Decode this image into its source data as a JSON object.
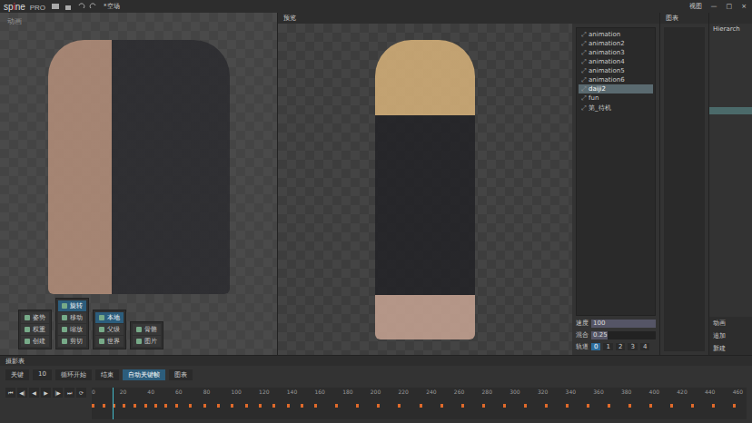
{
  "app": {
    "logo": "sp",
    "logo_i": "i",
    "logo_end": "ne",
    "edition": "PRO",
    "title": "*空场",
    "view_menu": "视图",
    "window_controls": [
      "—",
      "□",
      "×"
    ]
  },
  "viewport": {
    "label": "动画",
    "art": "canvas artwork (not reproduced)"
  },
  "tool_groups": [
    {
      "name": "Tools",
      "items": [
        {
          "label": "姿势",
          "selected": false
        },
        {
          "label": "权重",
          "selected": false
        },
        {
          "label": "创建",
          "selected": false
        }
      ]
    },
    {
      "name": "Transform",
      "items": [
        {
          "label": "旋转",
          "selected": true
        },
        {
          "label": "移动",
          "selected": false
        },
        {
          "label": "缩放",
          "selected": false
        },
        {
          "label": "剪切",
          "selected": false
        }
      ]
    },
    {
      "name": "Axes",
      "items": [
        {
          "label": "本地",
          "selected": true
        },
        {
          "label": "父级",
          "selected": false
        },
        {
          "label": "世界",
          "selected": false
        }
      ]
    },
    {
      "name": "Compensate",
      "items": [
        {
          "label": "骨骼",
          "selected": false
        },
        {
          "label": "图片",
          "selected": false
        }
      ]
    }
  ],
  "preview": {
    "tab": "预览",
    "art": "preview artwork (not reproduced)",
    "animations": [
      {
        "label": "animation",
        "selected": false
      },
      {
        "label": "animation2",
        "selected": false
      },
      {
        "label": "animation3",
        "selected": false
      },
      {
        "label": "animation4",
        "selected": false
      },
      {
        "label": "animation5",
        "selected": false
      },
      {
        "label": "animation6",
        "selected": false
      },
      {
        "label": "daiji2",
        "selected": true
      },
      {
        "label": "fun",
        "selected": false
      },
      {
        "label": "第_待机",
        "selected": false
      }
    ],
    "speed": {
      "label": "速度",
      "value": "100",
      "level": 1.0
    },
    "mix": {
      "label": "混合",
      "value": "0.25",
      "level": 0.25
    },
    "tracks": {
      "label": "轨道",
      "items": [
        {
          "label": "0",
          "selected": true
        },
        {
          "label": "1",
          "selected": false
        },
        {
          "label": "2",
          "selected": false
        },
        {
          "label": "3",
          "selected": false
        },
        {
          "label": "4",
          "selected": false
        }
      ]
    }
  },
  "graph_panel": {
    "title": "图表"
  },
  "hierarchy": {
    "title": "Hierarch",
    "footer": [
      "动画",
      "追加",
      "新建"
    ]
  },
  "timeline": {
    "title": "摄影表",
    "fields": [
      "关键",
      "10",
      "循环开始",
      "结束"
    ],
    "auto_key": {
      "label": "自动关键帧",
      "on": true
    },
    "graph_button": "图表",
    "transport": [
      "⏮",
      "◀|",
      "◀",
      "▶",
      "|▶",
      "⏭",
      "⟳"
    ],
    "ruler": [
      "0",
      "20",
      "40",
      "60",
      "80",
      "100",
      "120",
      "140",
      "160",
      "180",
      "200",
      "220",
      "240",
      "260",
      "280",
      "300",
      "320",
      "340",
      "360",
      "380",
      "400",
      "420",
      "440",
      "460"
    ],
    "max_frame": 470,
    "playhead": 15,
    "keys": [
      0,
      8,
      15,
      22,
      30,
      38,
      45,
      52,
      60,
      70,
      80,
      90,
      100,
      110,
      120,
      130,
      140,
      150,
      160,
      175,
      190,
      205,
      220,
      235,
      250,
      265,
      280,
      295,
      310,
      325,
      340,
      355,
      370,
      385,
      400,
      415,
      430,
      445,
      460
    ]
  }
}
